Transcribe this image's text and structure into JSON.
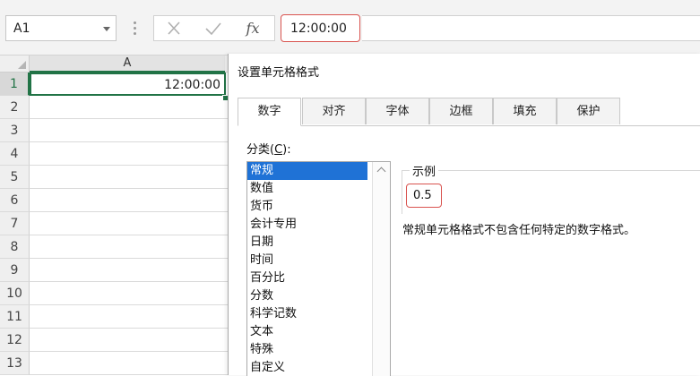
{
  "formula_bar": {
    "name_box": "A1",
    "fx_label": "fx",
    "formula_value": "12:00:00"
  },
  "sheet": {
    "column_headers": [
      "A"
    ],
    "rows": [
      "1",
      "2",
      "3",
      "4",
      "5",
      "6",
      "7",
      "8",
      "9",
      "10",
      "11",
      "12",
      "13"
    ],
    "active_cell_value": "12:00:00"
  },
  "dialog": {
    "title": "设置单元格格式",
    "tabs": [
      "数字",
      "对齐",
      "字体",
      "边框",
      "填充",
      "保护"
    ],
    "category_label_prefix": "分类(",
    "category_label_key": "C",
    "category_label_suffix": "):",
    "categories": [
      "常规",
      "数值",
      "货币",
      "会计专用",
      "日期",
      "时间",
      "百分比",
      "分数",
      "科学记数",
      "文本",
      "特殊",
      "自定义"
    ],
    "selected_category": "常规",
    "sample_label": "示例",
    "sample_value": "0.5",
    "description": "常规单元格格式不包含任何特定的数字格式。"
  },
  "colors": {
    "excel_green": "#217346",
    "highlight_red": "#d9534f",
    "selection_blue": "#1f72d6"
  }
}
